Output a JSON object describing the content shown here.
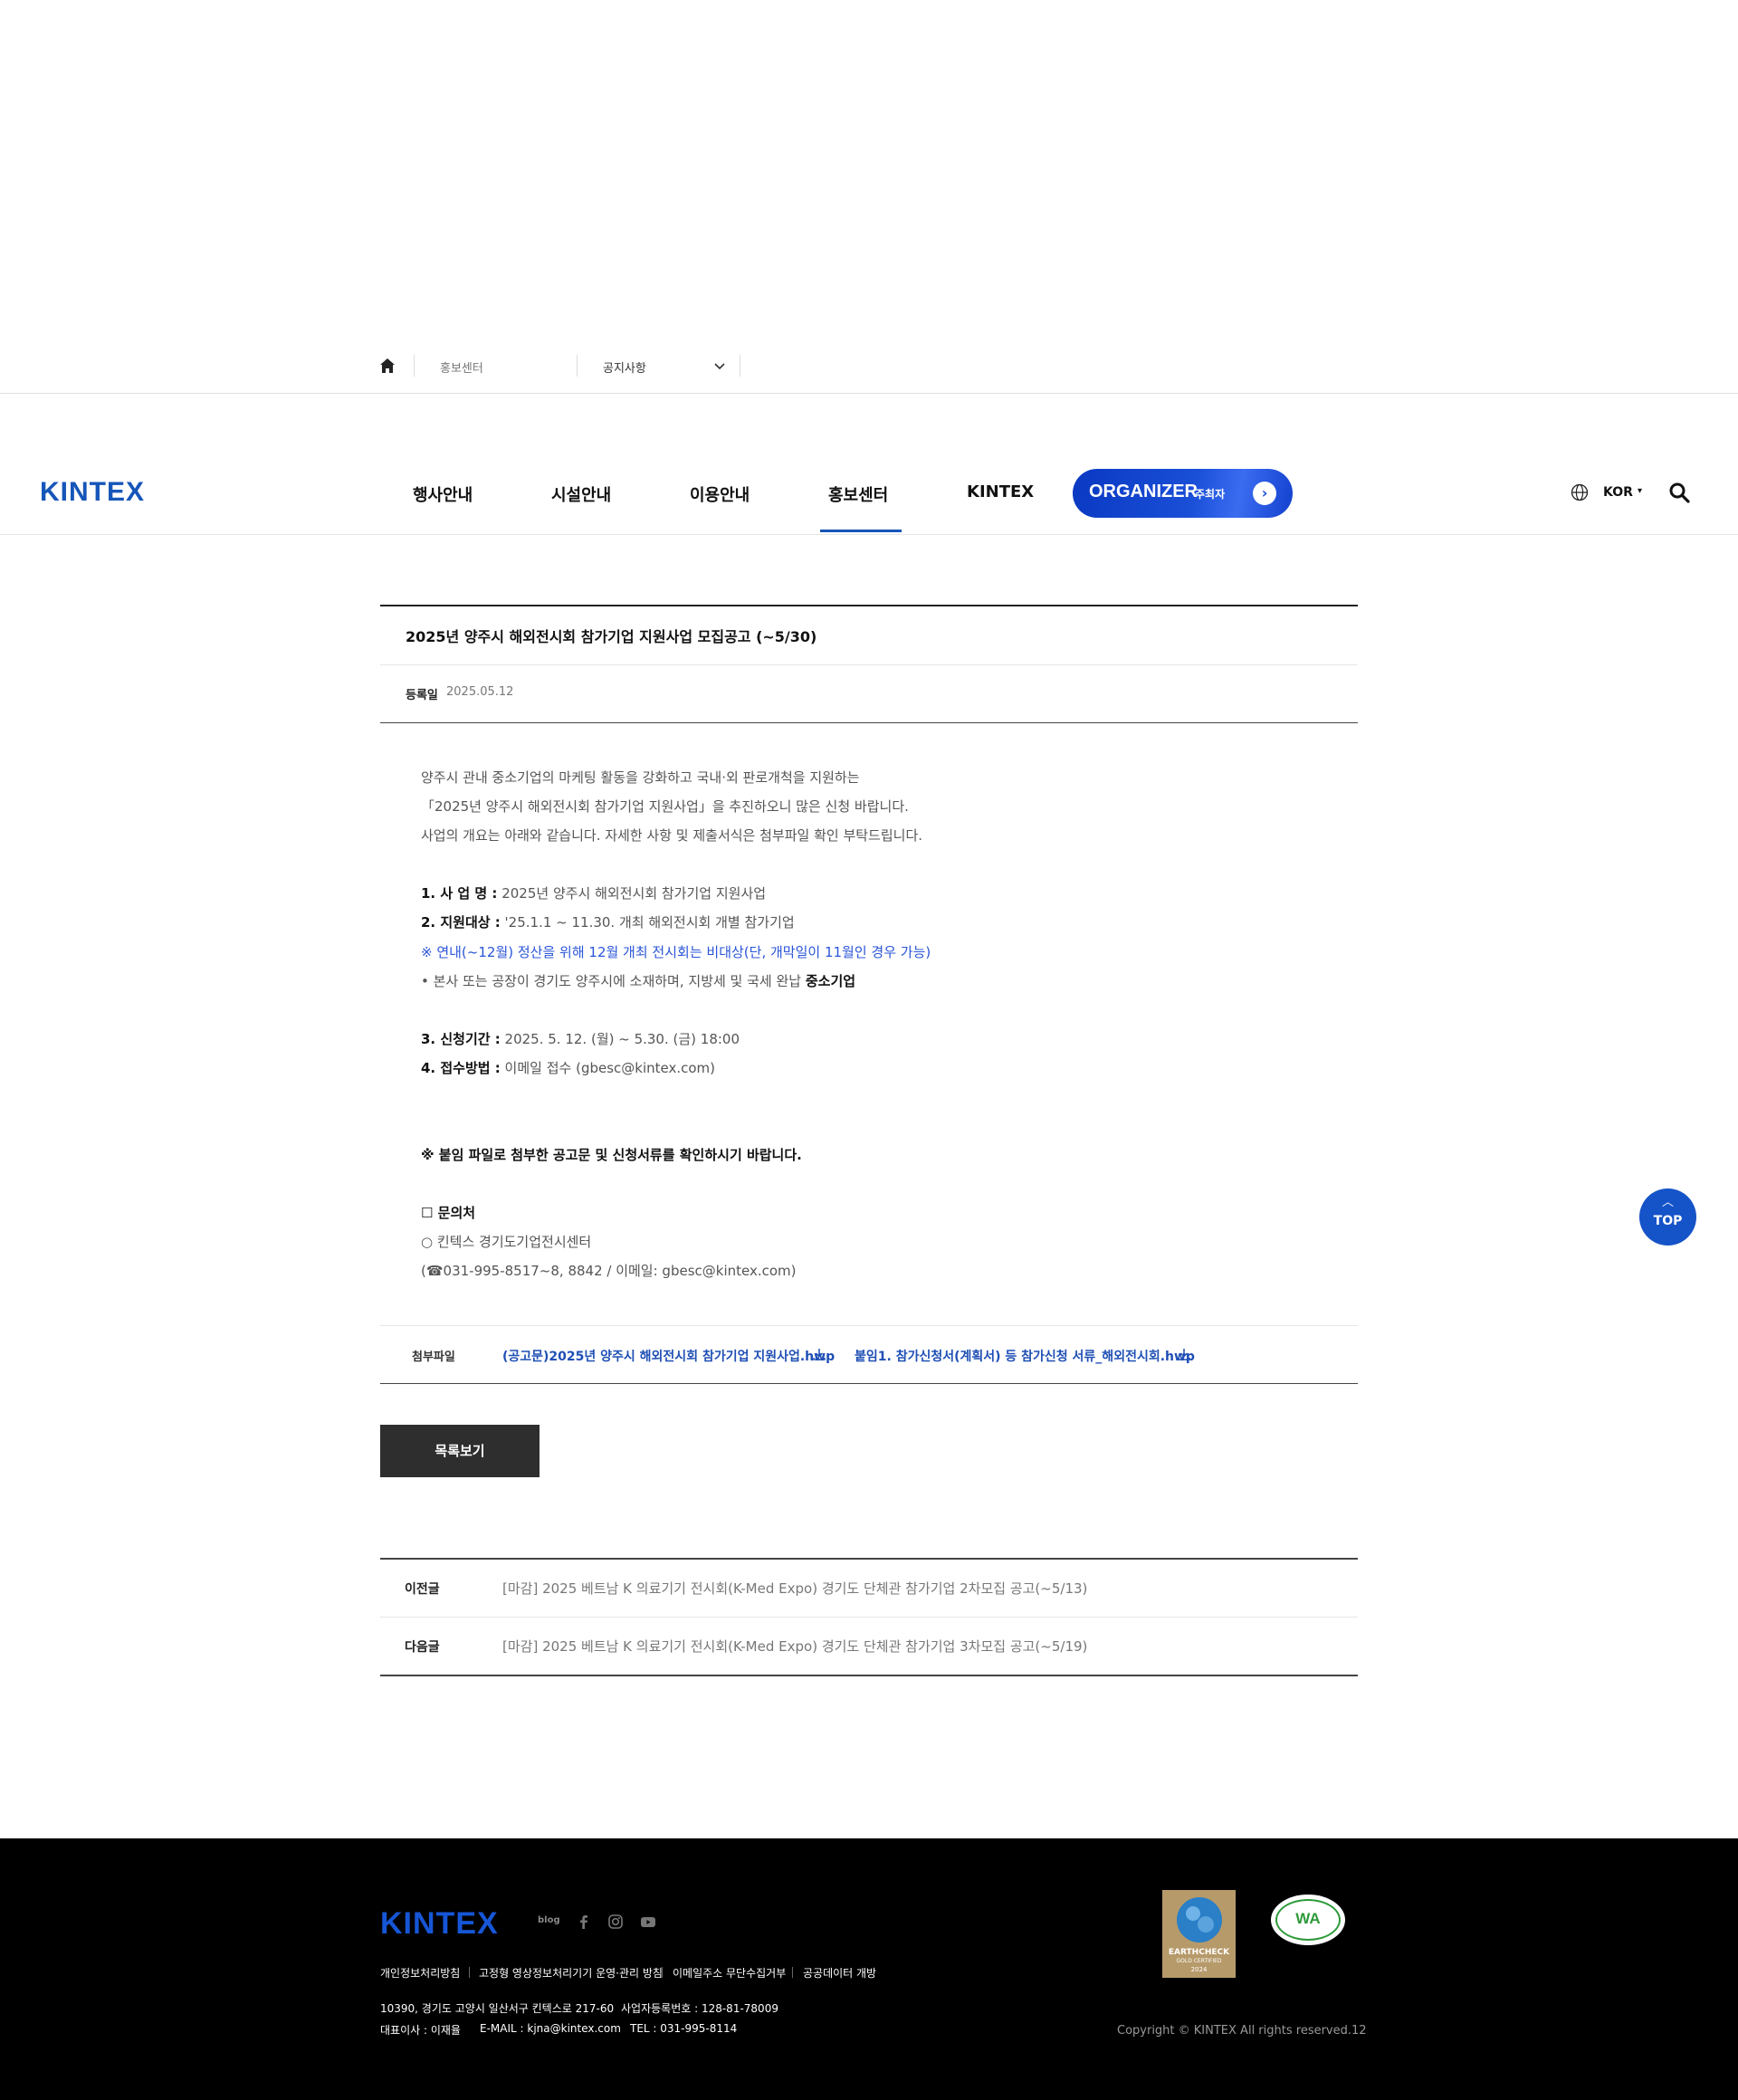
{
  "breadcrumb": {
    "section": "홍보센터",
    "current": "공지사항"
  },
  "header": {
    "logo": "KINTEX",
    "nav": [
      "행사안내",
      "시설안내",
      "이용안내",
      "홍보센터",
      "KINTEX"
    ],
    "active_nav": "홍보센터",
    "organizer_label": "ORGANIZER",
    "organizer_sub": "주최자",
    "language": "KOR",
    "accent_color": "#1656b9"
  },
  "article": {
    "title": "2025년 양주시 해외전시회 참가기업 지원사업 모집공고 (~5/30)",
    "date_label": "등록일",
    "date": "2025.05.12",
    "intro": [
      "양주시 관내 중소기업의 마케팅 활동을 강화하고 국내·외 판로개척을 지원하는",
      "「2025년 양주시 해외전시회 참가기업 지원사업」을 추진하오니 많은 신청 바랍니다.",
      "사업의 개요는 아래와 같습니다. 자세한 사항 및 제출서식은 첨부파일 확인 부탁드립니다."
    ],
    "item1_label": "1. 사 업 명 :",
    "item1_value": " 2025년 양주시 해외전시회 참가기업 지원사업",
    "item2_label": "2. 지원대상 :",
    "item2_value": " '25.1.1 ~ 11.30. 개최 해외전시회 개별 참가기업",
    "note_blue": "※ 연내(~12월) 정산을 위해 12월 개최 전시회는 비대상(단, 개막일이 11월인 경우 가능)",
    "bullet_prefix": "• 본사 또는 공장이 경기도 양주시에 소재하며, 지방세 및 국세 완납 ",
    "bullet_strong": "중소기업",
    "item3_label": "3. 신청기간 :",
    "item3_value": " 2025. 5. 12. (월) ~ 5.30. (금) 18:00",
    "item4_label": "4. 접수방법 :",
    "item4_value": " 이메일 접수 (gbesc@kintex.com)",
    "notice": "※ 붙임 파일로 첨부한 공고문 및 신청서류를 확인하시기 바랍니다.",
    "contact_title": "☐ 문의처",
    "contact_org": "○ 킨텍스 경기도기업전시센터",
    "contact_detail": "(☎031-995-8517~8, 8842 / 이메일: gbesc@kintex.com)"
  },
  "attachments": {
    "label": "첨부파일",
    "files": [
      "(공고문)2025년 양주시 해외전시회 참가기업 지원사업.hwp",
      "붙임1. 참가신청서(계획서) 등 참가신청 서류_해외전시회.hwp"
    ]
  },
  "list_button": "목록보기",
  "prev_next": {
    "prev_label": "이전글",
    "prev_title": "[마감] 2025 베트남 K 의료기기 전시회(K-Med Expo) 경기도 단체관 참가기업 2차모집 공고(~5/13)",
    "next_label": "다음글",
    "next_title": "[마감] 2025 베트남 K 의료기기 전시회(K-Med Expo) 경기도 단체관 참가기업 3차모집 공고(~5/19)"
  },
  "top_button": "TOP",
  "footer": {
    "logo": "KINTEX",
    "blog": "blog",
    "links": [
      "개인정보처리방침",
      "고정형 영상정보처리기기 운영·관리 방침",
      "이메일주소 무단수집거부",
      "공공데이터 개방"
    ],
    "address": "10390, 경기도 고양시 일산서구 킨텍스로 217-60",
    "biz_no": "사업자등록번호 : 128-81-78009",
    "ceo": "대표이사 : 이재율",
    "email": "E-MAIL : kjna@kintex.com",
    "tel": "TEL : 031-995-8114",
    "copyright": "Copyright © KINTEX All rights reserved.12",
    "badge_earth_lines": [
      "EARTHCHECK",
      "GOLD CERTIFIED",
      "2024"
    ],
    "badge_wa": "WA"
  }
}
